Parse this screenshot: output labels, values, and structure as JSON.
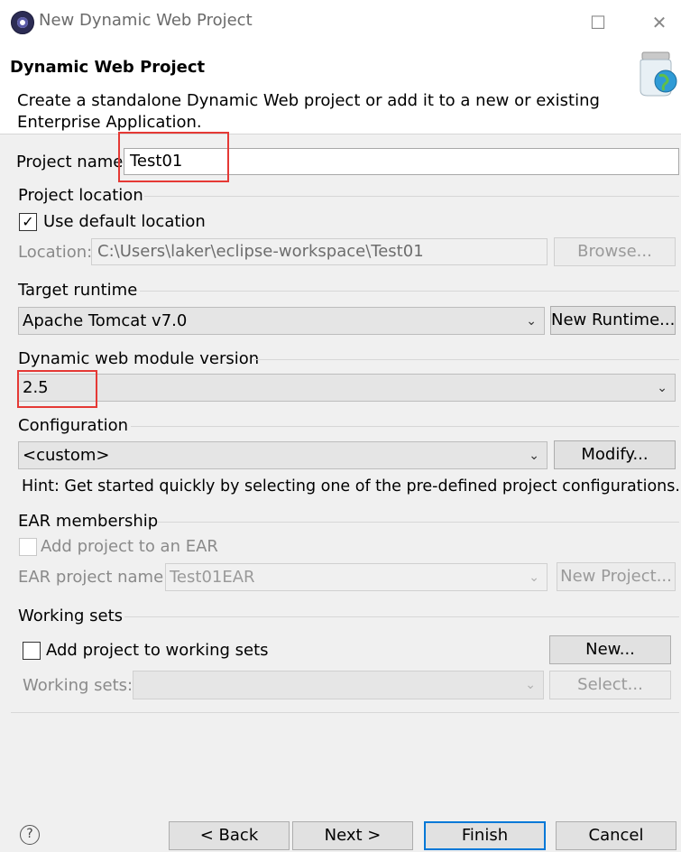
{
  "window": {
    "title": "New Dynamic Web Project",
    "minimize_glyph": "☐",
    "close_glyph": "✕",
    "app_icon": "eclipse-icon"
  },
  "header": {
    "title": "Dynamic Web Project",
    "description": "Create a standalone Dynamic Web project or add it to a new or existing Enterprise Application.",
    "banner_icon": "jar-globe-icon"
  },
  "project_name": {
    "label": "Project name",
    "value": "Test01"
  },
  "project_location": {
    "group_label": "Project location",
    "use_default_label": "Use default location",
    "use_default_checked": true,
    "location_label": "Location:",
    "location_value": "C:\\Users\\laker\\eclipse-workspace\\Test01",
    "browse_label": "Browse..."
  },
  "target_runtime": {
    "group_label": "Target runtime",
    "selected": "Apache Tomcat v7.0",
    "new_runtime_label": "New Runtime..."
  },
  "module_version": {
    "group_label": "Dynamic web module version",
    "selected": "2.5"
  },
  "configuration": {
    "group_label": "Configuration",
    "selected": "<custom>",
    "modify_label": "Modify...",
    "hint": "Hint: Get started quickly by selecting one of the pre-defined project configurations."
  },
  "ear": {
    "group_label": "EAR membership",
    "add_label": "Add project to an EAR",
    "add_checked": false,
    "name_label": "EAR project name:",
    "name_value": "Test01EAR",
    "new_project_label": "New Project..."
  },
  "working_sets": {
    "group_label": "Working sets",
    "add_label": "Add project to working sets",
    "add_checked": false,
    "new_label": "New...",
    "sets_label": "Working sets:",
    "sets_value": "",
    "select_label": "Select..."
  },
  "footer": {
    "help_glyph": "?",
    "back_label": "< Back",
    "next_label": "Next >",
    "finish_label": "Finish",
    "cancel_label": "Cancel"
  },
  "colors": {
    "annotation_red": "#e53935",
    "default_button_blue": "#0078d7"
  }
}
